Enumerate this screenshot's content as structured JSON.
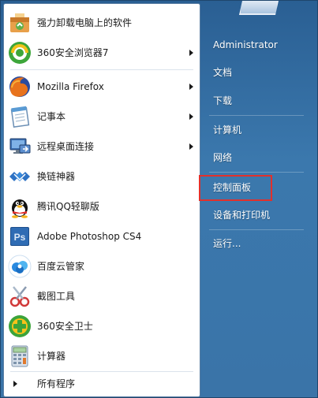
{
  "programs": [
    {
      "label": "强力卸载电脑上的软件",
      "icon": "uninstaller-icon",
      "has_submenu": false
    },
    {
      "label": "360安全浏览器7",
      "icon": "360-browser-icon",
      "has_submenu": true
    },
    {
      "label": "Mozilla Firefox",
      "icon": "firefox-icon",
      "has_submenu": true
    },
    {
      "label": "记事本",
      "icon": "notepad-icon",
      "has_submenu": true
    },
    {
      "label": "远程桌面连接",
      "icon": "remote-desktop-icon",
      "has_submenu": true
    },
    {
      "label": "换链神器",
      "icon": "link-tool-icon",
      "has_submenu": false
    },
    {
      "label": "腾讯QQ轻聊版",
      "icon": "qq-icon",
      "has_submenu": false
    },
    {
      "label": "Adobe Photoshop CS4",
      "icon": "photoshop-icon",
      "has_submenu": false
    },
    {
      "label": "百度云管家",
      "icon": "baidu-cloud-icon",
      "has_submenu": false
    },
    {
      "label": "截图工具",
      "icon": "snipping-tool-icon",
      "has_submenu": false
    },
    {
      "label": "360安全卫士",
      "icon": "360-safe-icon",
      "has_submenu": false
    },
    {
      "label": "计算器",
      "icon": "calculator-icon",
      "has_submenu": false
    }
  ],
  "all_programs_label": "所有程序",
  "right_items": [
    {
      "label": "Administrator"
    },
    {
      "label": "文档"
    },
    {
      "label": "下载"
    },
    {
      "label": "计算机"
    },
    {
      "label": "网络"
    },
    {
      "label": "控制面板",
      "highlighted": true
    },
    {
      "label": "设备和打印机"
    },
    {
      "label": "运行..."
    }
  ],
  "colors": {
    "menu_blue": "#3a74a8",
    "highlight_red": "#e2302b"
  }
}
